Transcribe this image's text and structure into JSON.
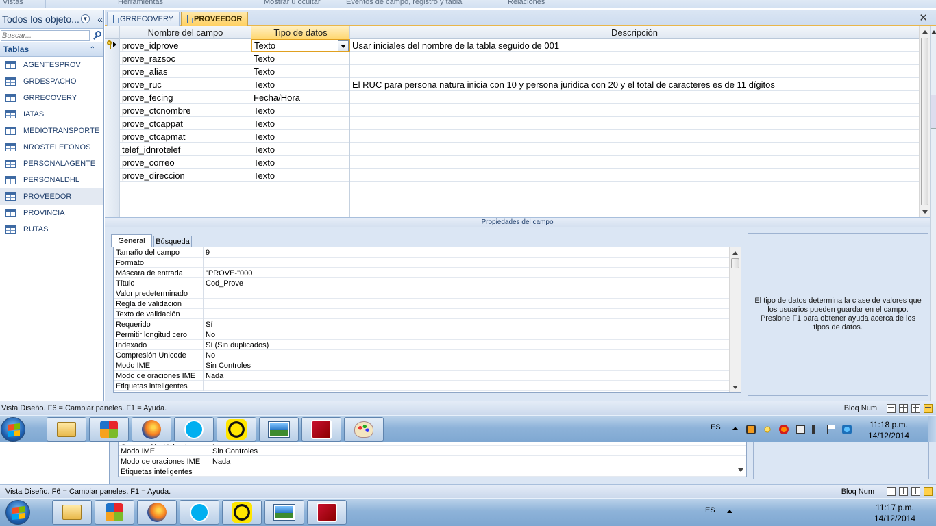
{
  "ribbon": {
    "groups": [
      "Vistas",
      "Herramientas",
      "Mostrar u ocultar",
      "Eventos de campo, registro y tabla",
      "Relaciones"
    ]
  },
  "nav": {
    "title": "Todos los objeto...",
    "search_placeholder": "Buscar...",
    "group_label": "Tablas",
    "items": [
      "AGENTESPROV",
      "GRDESPACHO",
      "GRRECOVERY",
      "IATAS",
      "MEDIOTRANSPORTE",
      "NROSTELEFONOS",
      "PERSONALAGENTE",
      "PERSONALDHL",
      "PROVEEDOR",
      "PROVINCIA",
      "RUTAS"
    ],
    "selected": "PROVEEDOR"
  },
  "tabs": [
    {
      "label": "GRRECOVERY",
      "active": false
    },
    {
      "label": "PROVEEDOR",
      "active": true
    }
  ],
  "grid": {
    "headers": [
      "Nombre del campo",
      "Tipo de datos",
      "Descripción"
    ],
    "rows": [
      {
        "name": "prove_idprove",
        "type": "Texto",
        "desc": "Usar iniciales del nombre de la tabla seguido de 001",
        "key": true
      },
      {
        "name": "prove_razsoc",
        "type": "Texto",
        "desc": ""
      },
      {
        "name": "prove_alias",
        "type": "Texto",
        "desc": ""
      },
      {
        "name": "prove_ruc",
        "type": "Texto",
        "desc": "El RUC para persona natura inicia con 10 y persona juridica con 20 y el total de caracteres es de 11 dígitos"
      },
      {
        "name": "prove_fecing",
        "type": "Fecha/Hora",
        "desc": ""
      },
      {
        "name": "prove_ctcnombre",
        "type": "Texto",
        "desc": ""
      },
      {
        "name": "prove_ctcappat",
        "type": "Texto",
        "desc": ""
      },
      {
        "name": "prove_ctcapmat",
        "type": "Texto",
        "desc": ""
      },
      {
        "name": "telef_idnrotelef",
        "type": "Texto",
        "desc": ""
      },
      {
        "name": "prove_correo",
        "type": "Texto",
        "desc": ""
      },
      {
        "name": "prove_direccion",
        "type": "Texto",
        "desc": ""
      },
      {
        "name": "",
        "type": "",
        "desc": ""
      },
      {
        "name": "",
        "type": "",
        "desc": ""
      },
      {
        "name": "",
        "type": "",
        "desc": ""
      }
    ]
  },
  "props": {
    "title": "Propiedades del campo",
    "tabs": [
      "General",
      "Búsqueda"
    ],
    "rows": [
      {
        "label": "Tamaño del campo",
        "value": "9"
      },
      {
        "label": "Formato",
        "value": ""
      },
      {
        "label": "Máscara de entrada",
        "value": "\"PROVE-\"000"
      },
      {
        "label": "Título",
        "value": "Cod_Prove"
      },
      {
        "label": "Valor predeterminado",
        "value": ""
      },
      {
        "label": "Regla de validación",
        "value": ""
      },
      {
        "label": "Texto de validación",
        "value": ""
      },
      {
        "label": "Requerido",
        "value": "Sí"
      },
      {
        "label": "Permitir longitud cero",
        "value": "No"
      },
      {
        "label": "Indexado",
        "value": "Sí (Sin duplicados)"
      },
      {
        "label": "Compresión Unicode",
        "value": "No"
      },
      {
        "label": "Modo IME",
        "value": "Sin Controles"
      },
      {
        "label": "Modo de oraciones IME",
        "value": "Nada"
      },
      {
        "label": "Etiquetas inteligentes",
        "value": ""
      }
    ],
    "help": "El tipo de datos determina la clase de valores que los usuarios pueden guardar en el campo. Presione F1 para obtener ayuda acerca de los tipos de datos."
  },
  "status": {
    "text": "Vista Diseño.  F6 = Cambiar paneles.  F1 = Ayuda.",
    "numlock": "Bloq Num"
  },
  "taskbar": {
    "lang": "ES",
    "time": "11:18 p.m.",
    "date": "14/12/2014",
    "apps": [
      "explorer",
      "avast",
      "firefox",
      "skype",
      "app-q",
      "image-viewer",
      "access",
      "paint"
    ]
  },
  "lower": {
    "rows": [
      {
        "label": "Compresión Unicode",
        "value": "No"
      },
      {
        "label": "Modo IME",
        "value": "Sin Controles"
      },
      {
        "label": "Modo de oraciones IME",
        "value": "Nada"
      },
      {
        "label": "Etiquetas inteligentes",
        "value": ""
      }
    ],
    "status_text": "Vista Diseño.  F6 = Cambiar paneles.  F1 = Ayuda.",
    "numlock": "Bloq Num",
    "lang": "ES",
    "time": "11:17 p.m.",
    "date": "14/12/2014"
  }
}
